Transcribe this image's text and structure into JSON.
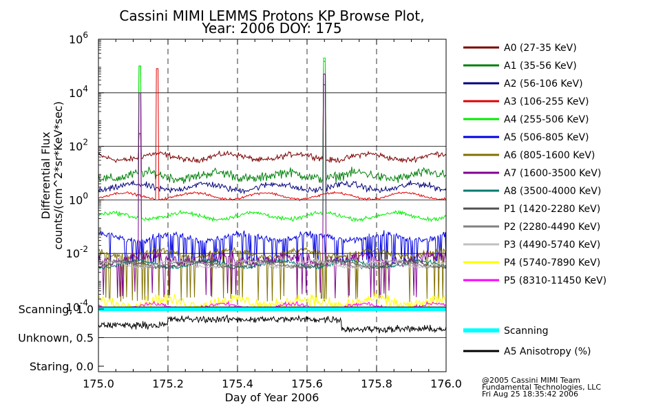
{
  "chart_data": [
    {
      "type": "line",
      "title": "Cassini MIMI LEMMS Protons KP Browse Plot,",
      "subtitle": "Year: 2006 DOY: 175",
      "ylabel_line1": "Differential Flux",
      "ylabel_line2": "counts/(cm^2*sr*KeV*sec)",
      "xlim": [
        175.0,
        176.0
      ],
      "ylim_log10": [
        -4,
        6
      ],
      "y_scale": "log",
      "grid": true,
      "legend_position": "right",
      "y_ticks": [
        {
          "base": "10",
          "exp": "6",
          "value": 1000000
        },
        {
          "base": "10",
          "exp": "4",
          "value": 10000
        },
        {
          "base": "10",
          "exp": "2",
          "value": 100
        },
        {
          "base": "10",
          "exp": "0",
          "value": 1
        },
        {
          "base": "10",
          "exp": "-2",
          "value": 0.01
        },
        {
          "base": "10",
          "exp": "-4",
          "value": 0.0001
        }
      ],
      "series": [
        {
          "name": "A0 (27-35 KeV)",
          "color": "#7a0000",
          "typical_flux": 40,
          "noise_decades": 0.07,
          "drop_prob": 0,
          "spikes": [
            {
              "x": 175.12,
              "peak": 300
            },
            {
              "x": 175.65,
              "peak": 50000
            }
          ]
        },
        {
          "name": "A1 (35-56 KeV)",
          "color": "#00800a",
          "typical_flux": 8,
          "noise_decades": 0.12,
          "drop_prob": 0,
          "spikes": [
            {
              "x": 175.12,
              "peak": 100000
            },
            {
              "x": 175.65,
              "peak": 150000
            }
          ]
        },
        {
          "name": "A2 (56-106 KeV)",
          "color": "#00007a",
          "typical_flux": 3,
          "noise_decades": 0.08,
          "drop_prob": 0,
          "spikes": [
            {
              "x": 175.65,
              "peak": 20000
            }
          ]
        },
        {
          "name": "A3 (106-255 KeV)",
          "color": "#e00000",
          "typical_flux": 1.4,
          "noise_decades": 0.03,
          "drop_prob": 0,
          "spikes": [
            {
              "x": 175.17,
              "peak": 80000
            }
          ]
        },
        {
          "name": "A4 (255-506 KeV)",
          "color": "#00ee00",
          "typical_flux": 0.25,
          "noise_decades": 0.05,
          "drop_prob": 0,
          "spikes": [
            {
              "x": 175.12,
              "peak": 100000
            },
            {
              "x": 175.65,
              "peak": 200000
            }
          ]
        },
        {
          "name": "A5 (506-805 KeV)",
          "color": "#0000e0",
          "typical_flux": 0.04,
          "noise_decades": 0.08,
          "drop_prob": 0.2,
          "drop_to": 0.005,
          "spikes": []
        },
        {
          "name": "A6 (805-1600 KeV)",
          "color": "#807000",
          "typical_flux": 0.01,
          "noise_decades": 0.08,
          "drop_prob": 0.1,
          "drop_to": 0.0002,
          "spikes": []
        },
        {
          "name": "A7 (1600-3500 KeV)",
          "color": "#800090",
          "typical_flux": 0.006,
          "noise_decades": 0.15,
          "drop_prob": 0.08,
          "drop_to": 0.0003,
          "spikes": [
            {
              "x": 175.12,
              "peak": 10000
            },
            {
              "x": 175.65,
              "peak": 50000
            }
          ]
        },
        {
          "name": "A8 (3500-4000 KeV)",
          "color": "#007a70",
          "typical_flux": 0.004,
          "noise_decades": 0.05,
          "drop_prob": 0,
          "spikes": []
        },
        {
          "name": "P1 (1420-2280 KeV)",
          "color": "#505050",
          "typical_flux": 0.004,
          "noise_decades": 0.05,
          "drop_prob": 0,
          "spikes": []
        },
        {
          "name": "P2 (2280-4490 KeV)",
          "color": "#808080",
          "typical_flux": 0.004,
          "noise_decades": 0.04,
          "drop_prob": 0,
          "spikes": []
        },
        {
          "name": "P3 (4490-5740 KeV)",
          "color": "#c0c0c0",
          "typical_flux": 0.004,
          "noise_decades": 0.04,
          "drop_prob": 0,
          "spikes": []
        },
        {
          "name": "P4 (5740-7890 KeV)",
          "color": "#ffff00",
          "typical_flux": 0.00015,
          "noise_decades": 0.15,
          "drop_prob": 0,
          "spikes": []
        },
        {
          "name": "P5 (8310-11450 KeV)",
          "color": "#ff00ff",
          "typical_flux": 0.0001,
          "noise_decades": 0.05,
          "drop_prob": 0,
          "spikes": []
        }
      ]
    },
    {
      "type": "line",
      "xlabel": "Day of Year 2006",
      "xlim": [
        175.0,
        176.0
      ],
      "x_ticks": [
        "175.0",
        "175.2",
        "175.4",
        "175.6",
        "175.8",
        "176.0"
      ],
      "x_tick_values": [
        175.0,
        175.2,
        175.4,
        175.6,
        175.8,
        176.0
      ],
      "ylim": [
        0.0,
        1.0
      ],
      "y_ticks": [
        {
          "label": "Scanning, 1.0",
          "value": 1.0
        },
        {
          "label": "Unknown, 0.5",
          "value": 0.5
        },
        {
          "label": "Staring, 0.0",
          "value": 0.0
        }
      ],
      "series": [
        {
          "name": "Scanning",
          "color": "#00ffff",
          "constant_value": 1.0
        },
        {
          "name": "A5 Anisotropy (%)",
          "color": "#000000",
          "typical_value": 0.75,
          "segments": [
            {
              "from": 175.0,
              "to": 175.2,
              "value": 0.72
            },
            {
              "from": 175.2,
              "to": 175.7,
              "value": 0.82
            },
            {
              "from": 175.7,
              "to": 176.0,
              "value": 0.65
            }
          ]
        }
      ]
    }
  ],
  "footer": {
    "line1": "@2005 Cassini MIMI Team",
    "line2": "Fundamental Technologies, LLC",
    "line3": "Fri Aug 25 18:35:42 2006"
  }
}
